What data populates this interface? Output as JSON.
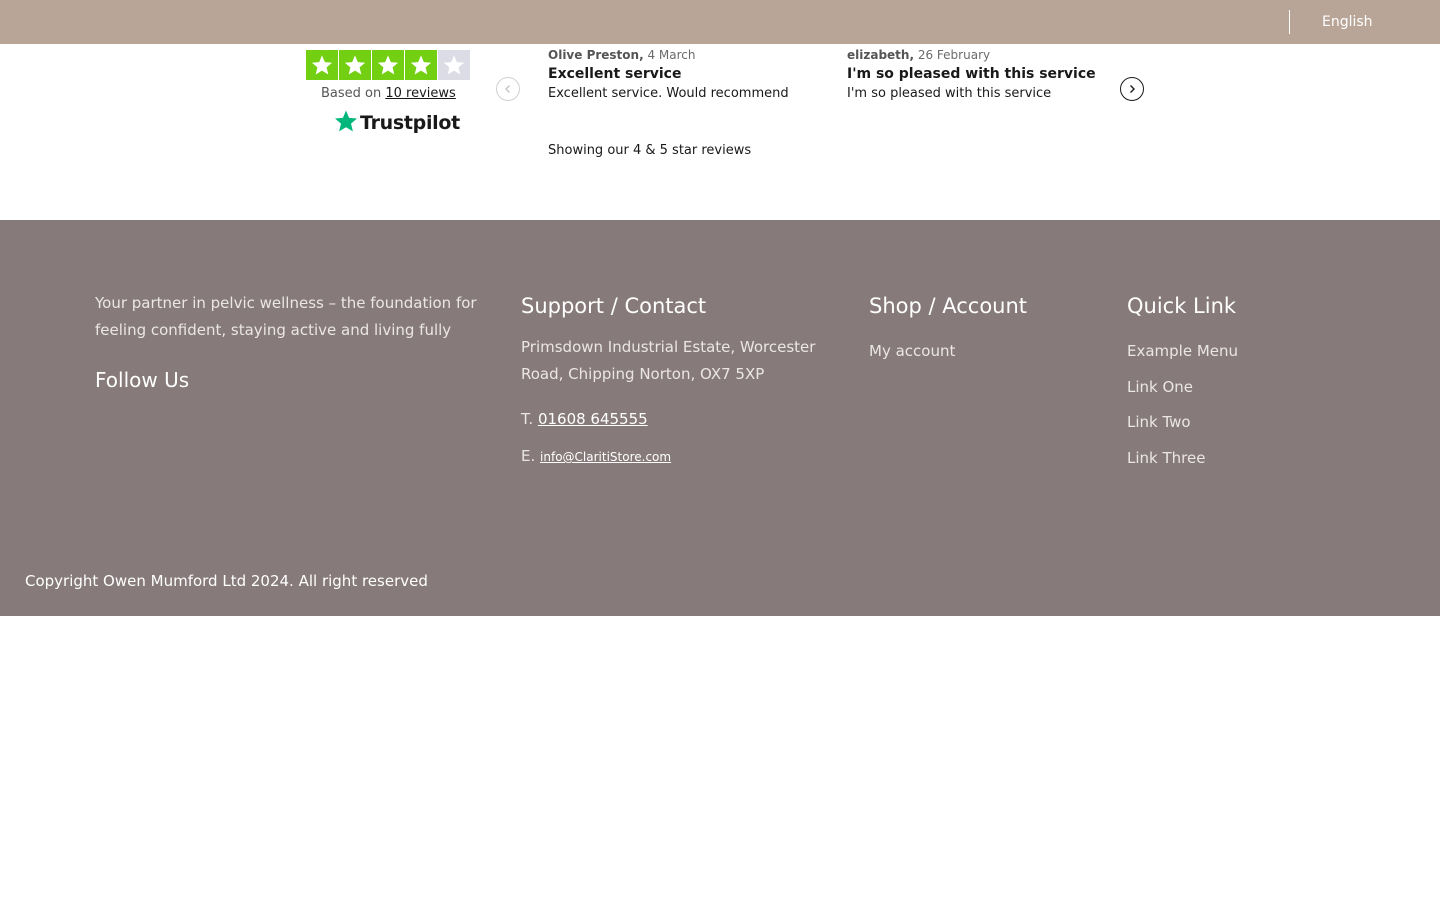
{
  "topbar": {
    "language": "English"
  },
  "trustpilot": {
    "rating_stars": 4,
    "based_on_prefix": "Based on",
    "reviews_link": "10 reviews",
    "logo_text": "Trustpilot",
    "colors": {
      "filled_star": "#73cf11",
      "empty_star": "#dcdce6",
      "logo_star": "#00b67a"
    },
    "reviews": [
      {
        "author": "Olive Preston,",
        "date": "4 March",
        "title": "Excellent service",
        "body": "Excellent service. Would recommend"
      },
      {
        "author": "elizabeth,",
        "date": "26 February",
        "title": "I'm so pleased with this service",
        "body": "I'm so pleased with this service"
      }
    ],
    "showing_text": "Showing our 4 & 5 star reviews"
  },
  "footer": {
    "tagline": "Your partner in pelvic wellness – the foundation for feeling confident, staying active and living fully",
    "follow_title": "Follow Us",
    "support": {
      "title": "Support / Contact",
      "address": "Primsdown Industrial Estate, Worcester Road, Chipping Norton, OX7 5XP",
      "phone_prefix": "T.",
      "phone": "01608 645555",
      "email_prefix": "E.",
      "email": "info@ClaritiStore.com"
    },
    "shop": {
      "title": "Shop / Account",
      "links": [
        "My account"
      ]
    },
    "quick": {
      "title": "Quick Link",
      "links": [
        "Example Menu",
        "Link One",
        "Link Two",
        "Link Three"
      ]
    },
    "copyright": "Copyright Owen Mumford Ltd 2024. All right reserved",
    "colors": {
      "background": "#867a7a",
      "topbar": "#b8a598"
    }
  }
}
